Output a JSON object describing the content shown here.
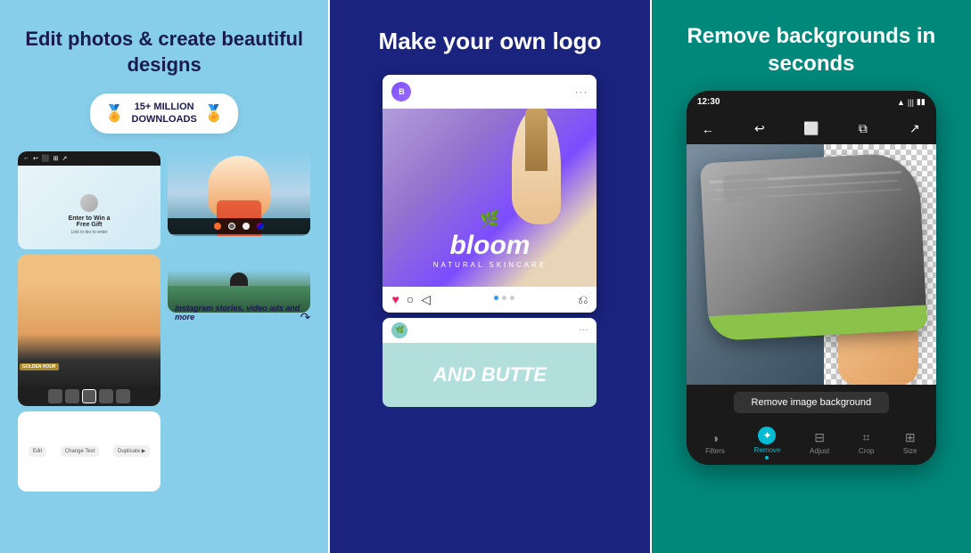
{
  "panel1": {
    "headline": "Edit photos & create beautiful designs",
    "badge": {
      "prefix": "15+ MILLION",
      "suffix": "DOWNLOADS"
    },
    "caption": "Instagram stories, video ads and more",
    "toolbar_items": [
      "Edit",
      "Change Text",
      "Duplicate"
    ]
  },
  "panel2": {
    "headline": "Make your own logo",
    "insta_handle": "",
    "bloom_text": "bloom",
    "bloom_tagline": "NATURAL SKINCARE",
    "butter_text": "AND BUTTE"
  },
  "panel3": {
    "headline": "Remove backgrounds in seconds",
    "status_time": "12:30",
    "remove_bg_label": "Remove image background",
    "tools": [
      {
        "label": "Filters",
        "active": false
      },
      {
        "label": "Remove",
        "active": true
      },
      {
        "label": "Adjust",
        "active": false
      },
      {
        "label": "Crop",
        "active": false
      },
      {
        "label": "Size",
        "active": false
      }
    ]
  },
  "colors": {
    "panel1_bg": "#87CEEB",
    "panel2_bg": "#1a237e",
    "panel3_bg": "#00897b",
    "accent_teal": "#00bcd4"
  }
}
